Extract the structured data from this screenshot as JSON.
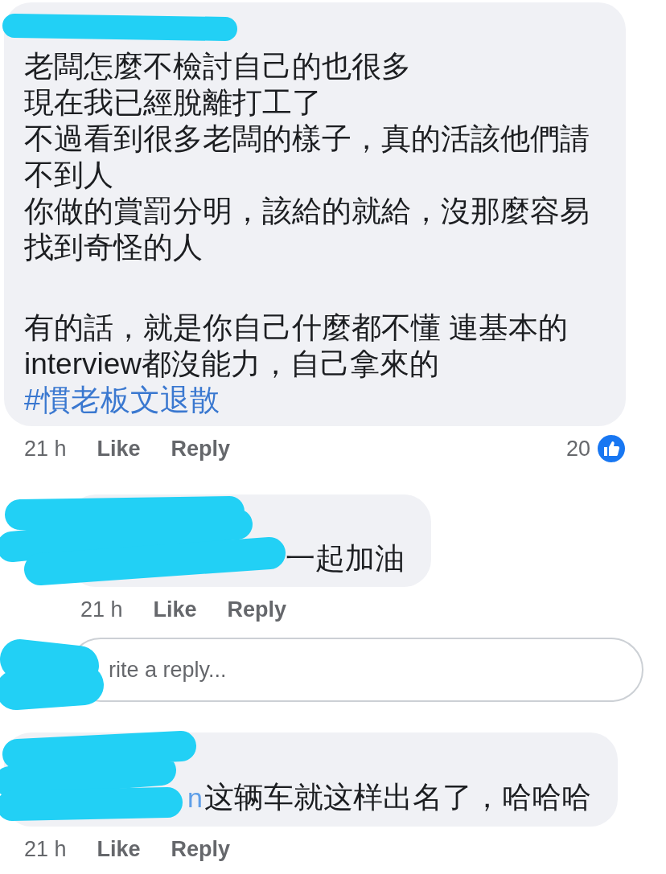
{
  "comments": [
    {
      "kind": "comment",
      "paragraphs": [
        [
          "老闆怎麼不檢討自己的也很多",
          "現在我已經脫離打工了",
          "不過看到很多老闆的樣子，真的活該他們請不到人",
          "你做的賞罰分明，該給的就給，沒那麼容易找到奇怪的人"
        ],
        [
          "有的話，就是你自己什麼都不懂 連基本的interview都沒能力，自己拿來的"
        ]
      ],
      "hashtag": "#慣老板文退散",
      "time": "21 h",
      "like": "Like",
      "reply": "Reply",
      "reaction_count": "20"
    },
    {
      "kind": "reply",
      "paragraphs": [
        [
          "一起加油"
        ]
      ],
      "time": "21 h",
      "like": "Like",
      "reply": "Reply"
    },
    {
      "kind": "reply_field",
      "placeholder": "rite a reply..."
    },
    {
      "kind": "comment",
      "author_tail": "n",
      "paragraphs": [
        [
          "这辆车就这样出名了，哈哈哈"
        ]
      ],
      "time": "21 h",
      "like": "Like",
      "reply": "Reply"
    }
  ]
}
